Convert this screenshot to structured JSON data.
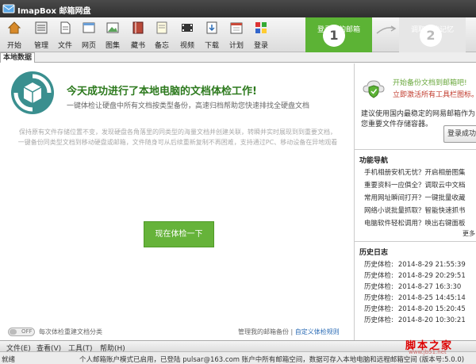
{
  "titlebar": {
    "app_name": "ImapBox 邮箱网盘"
  },
  "toolbar": {
    "items": [
      {
        "label": "开始",
        "icon": "home-icon"
      },
      {
        "label": "管理",
        "icon": "manage-icon"
      },
      {
        "label": "文件",
        "icon": "file-icon"
      },
      {
        "label": "网页",
        "icon": "webpage-icon"
      },
      {
        "label": "图集",
        "icon": "gallery-icon"
      },
      {
        "label": "藏书",
        "icon": "book-icon"
      },
      {
        "label": "备忘",
        "icon": "memo-icon"
      },
      {
        "label": "视频",
        "icon": "video-icon"
      },
      {
        "label": "下载",
        "icon": "download-icon"
      },
      {
        "label": "计划",
        "icon": "calendar-icon"
      },
      {
        "label": "登录",
        "icon": "login-icon"
      }
    ],
    "step1": {
      "text": "登录我的邮箱",
      "number": "1"
    },
    "step2": {
      "text": "调取我的记忆",
      "number": "2"
    }
  },
  "tabs": {
    "active": "本地数据"
  },
  "main": {
    "title": "今天成功进行了本地电脑的文档体检工作!",
    "subtitle": "一键体检让硬盘中所有文档按类型备份，高速归档帮助您快速排找全硬盘文档",
    "desc_line1": "保持原有文件存储位置不变，发现硬盘各角落里的同类型的海量文档并创建关联，转瞬并实时展现到到重要文档，",
    "desc_line2": "一键备份同类型文档到移动硬盘或邮箱，文件随身可从后续重新复制不再困难，支持通过PC、移动设备在异地观看",
    "check_button": "现在体检一下",
    "toggle_state": "OFF",
    "toggle_label": "每次体检重建文档分类",
    "link_manage": "管理我的邮箱备份",
    "link_separator": " | ",
    "link_rules": "自定义体检规则"
  },
  "sidebar": {
    "promo_line1": "开始备份文档到邮箱吧!",
    "promo_line2": "立即激活所有工具栏图标。",
    "promo_desc": "建议使用国内最稳定的网易邮箱作为您重要文件存储容器。",
    "login_button": "登录成功",
    "nav_title": "功能导航",
    "nav_items": [
      "手机相册安机无忧？开启相册图集",
      "重要资料一应俱全？调取云中文档",
      "常用网址瞬间打开？一键批量收藏",
      "网络小说批量抓取？智能快速抓书",
      "电脑软件轻松调用？唤出右键面板"
    ],
    "more": "更多",
    "log_title": "历史日志",
    "logs": [
      {
        "label": "历史体检:",
        "date": "2014-8-29 21:55:39"
      },
      {
        "label": "历史体检:",
        "date": "2014-8-29 20:29:51"
      },
      {
        "label": "历史体检:",
        "date": "2014-8-27 16:3:30"
      },
      {
        "label": "历史体检:",
        "date": "2014-8-25 14:45:14"
      },
      {
        "label": "历史体检:",
        "date": "2014-8-20 15:20:45"
      },
      {
        "label": "历史体检:",
        "date": "2014-8-20 10:30:21"
      }
    ]
  },
  "menubar": {
    "items": [
      "文件(E)",
      "查看(V)",
      "工具(T)",
      "帮助(H)"
    ]
  },
  "statusbar": {
    "state": "就绪",
    "message": "个人邮箱账户模式已启用，已登陆 pulsar@163.com 账户中所有邮箱空间，数据可存入本地电脑和远程邮箱空间 (版本号:5.0.0)"
  },
  "watermark": {
    "text": "脚本之家",
    "url": "www.jb51.net"
  },
  "colors": {
    "accent_green": "#66b33a",
    "title_green": "#2d7a1e",
    "link_blue": "#2a6bb5"
  }
}
